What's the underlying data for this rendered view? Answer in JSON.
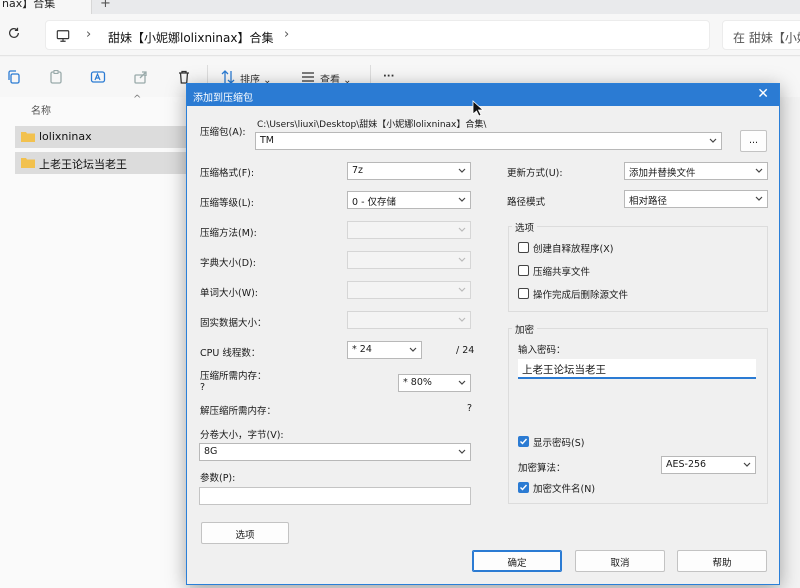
{
  "explorer": {
    "tab_title": "nax】合集",
    "new_tab": "+",
    "breadcrumb": "甜妹【小妮娜lolixninax】合集",
    "search_placeholder": "在 甜妹【小妮",
    "toolbar": {
      "sort_label": "排序",
      "view_label": "查看",
      "more_label": "···"
    },
    "column_name": "名称",
    "files": [
      "lolixninax",
      "上老王论坛当老王"
    ]
  },
  "dialog": {
    "title": "添加到压缩包",
    "archive_label": "压缩包(A):",
    "archive_path": "C:\\Users\\liuxi\\Desktop\\甜妹【小妮娜lolixninax】合集\\",
    "archive_name": "TM",
    "browse_label": "...",
    "format_label": "压缩格式(F):",
    "format_value": "7z",
    "level_label": "压缩等级(L):",
    "level_value": "0 - 仅存储",
    "method_label": "压缩方法(M):",
    "dict_label": "字典大小(D):",
    "word_label": "单词大小(W):",
    "solid_label": "固实数据大小：",
    "threads_label": "CPU 线程数：",
    "threads_value": "* 24",
    "threads_total": "/ 24",
    "mem_comp_label": "压缩所需内存：",
    "mem_comp_value": "?",
    "mem_comp_combo": "* 80%",
    "mem_decomp_label": "解压缩所需内存：",
    "mem_decomp_value": "?",
    "volume_label": "分卷大小，字节(V):",
    "volume_value": "8G",
    "params_label": "参数(P):",
    "params_value": "",
    "options_button": "选项",
    "update_label": "更新方式(U):",
    "update_value": "添加并替换文件",
    "path_label": "路径模式",
    "path_value": "相对路径",
    "options_group": "选项",
    "opt_sfx": "创建自释放程序(X)",
    "opt_shared": "压缩共享文件",
    "opt_delete": "操作完成后删除源文件",
    "encrypt_group": "加密",
    "pwd_label": "输入密码：",
    "pwd_value": "上老王论坛当老王",
    "show_pwd": "显示密码(S)",
    "enc_method_label": "加密算法：",
    "enc_method_value": "AES-256",
    "enc_names": "加密文件名(N)",
    "ok": "确定",
    "cancel": "取消",
    "help": "帮助",
    "close_glyph": "✕"
  },
  "colors": {
    "accent": "#2b7bd3",
    "folder": "#f2c14e"
  }
}
